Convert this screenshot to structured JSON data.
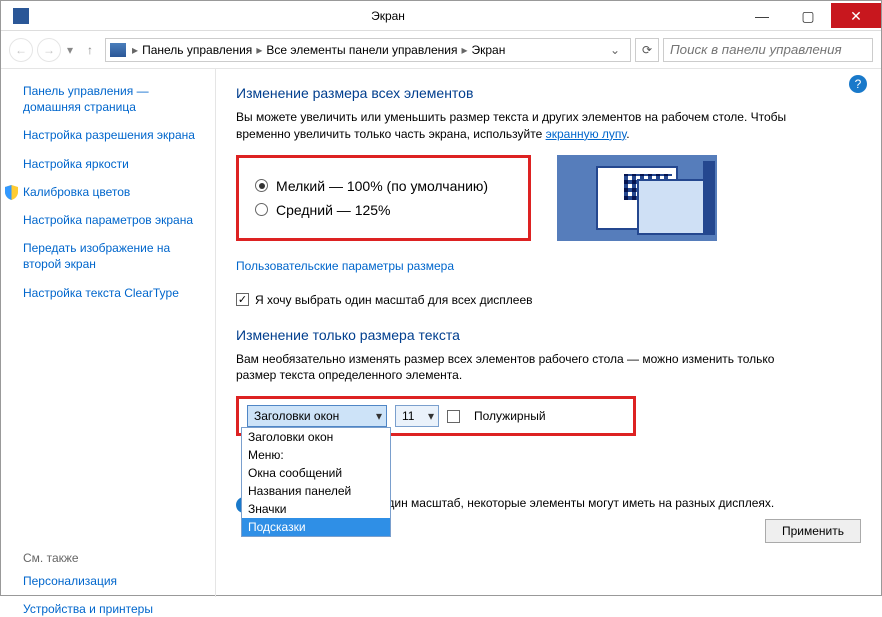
{
  "window": {
    "title": "Экран"
  },
  "breadcrumbs": {
    "items": [
      "Панель управления",
      "Все элементы панели управления",
      "Экран"
    ]
  },
  "search": {
    "placeholder": "Поиск в панели управления"
  },
  "sidebar": {
    "links": [
      "Панель управления — домашняя страница",
      "Настройка разрешения экрана",
      "Настройка яркости",
      "Калибровка цветов",
      "Настройка параметров экрана",
      "Передать изображение на второй экран",
      "Настройка текста ClearType"
    ],
    "see_also_label": "См. также",
    "see_also": [
      "Персонализация",
      "Устройства и принтеры"
    ]
  },
  "main": {
    "heading1": "Изменение размера всех элементов",
    "intro_a": "Вы можете увеличить или уменьшить размер текста и других элементов на рабочем столе. Чтобы временно увеличить только часть экрана, используйте ",
    "intro_link": "экранную лупу",
    "intro_b": ".",
    "radio_small": "Мелкий — 100% (по умолчанию)",
    "radio_medium": "Средний — 125%",
    "custom_link": "Пользовательские параметры размера",
    "one_scale_checkbox": "Я хочу выбрать один масштаб для всех дисплеев",
    "heading2": "Изменение только размера текста",
    "text_intro": "Вам необязательно изменять размер всех элементов рабочего стола — можно изменить только размер текста определенного элемента.",
    "element_select": "Заголовки окон",
    "size_select": "11",
    "bold_label": "Полужирный",
    "dropdown_options": [
      "Заголовки окон",
      "Меню:",
      "Окна сообщений",
      "Названия панелей",
      "Значки",
      "Подсказки"
    ],
    "note": "Если вы используете один масштаб, некоторые элементы могут иметь на разных дисплеях.",
    "apply": "Применить"
  }
}
